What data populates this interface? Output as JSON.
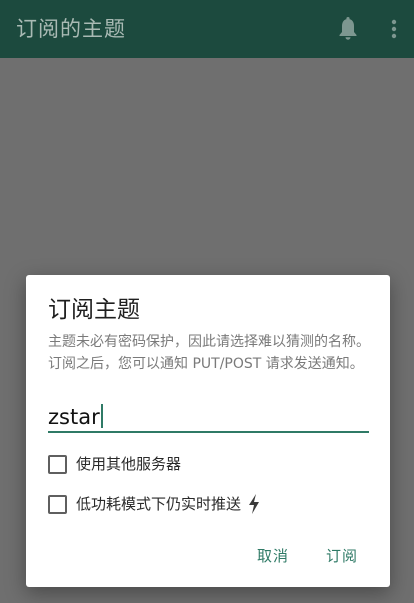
{
  "appbar": {
    "title": "订阅的主题",
    "bell_icon": "bell-icon",
    "menu_icon": "more-vert-icon"
  },
  "dialog": {
    "title": "订阅主题",
    "description": "主题未必有密码保护，因此请选择难以猜测的名称。订阅之后，您可以通知 PUT/POST 请求发送通知。",
    "topic_value": "zstar",
    "option_other_server": "使用其他服务器",
    "option_low_power": "低功耗模式下仍实时推送",
    "option_low_power_icon": "lightning-bolt-icon",
    "cancel_label": "取消",
    "subscribe_label": "订阅"
  },
  "colors": {
    "appbar": "#1c4a3e",
    "accent": "#2f7a66",
    "scrim": "#6f6f6f"
  }
}
